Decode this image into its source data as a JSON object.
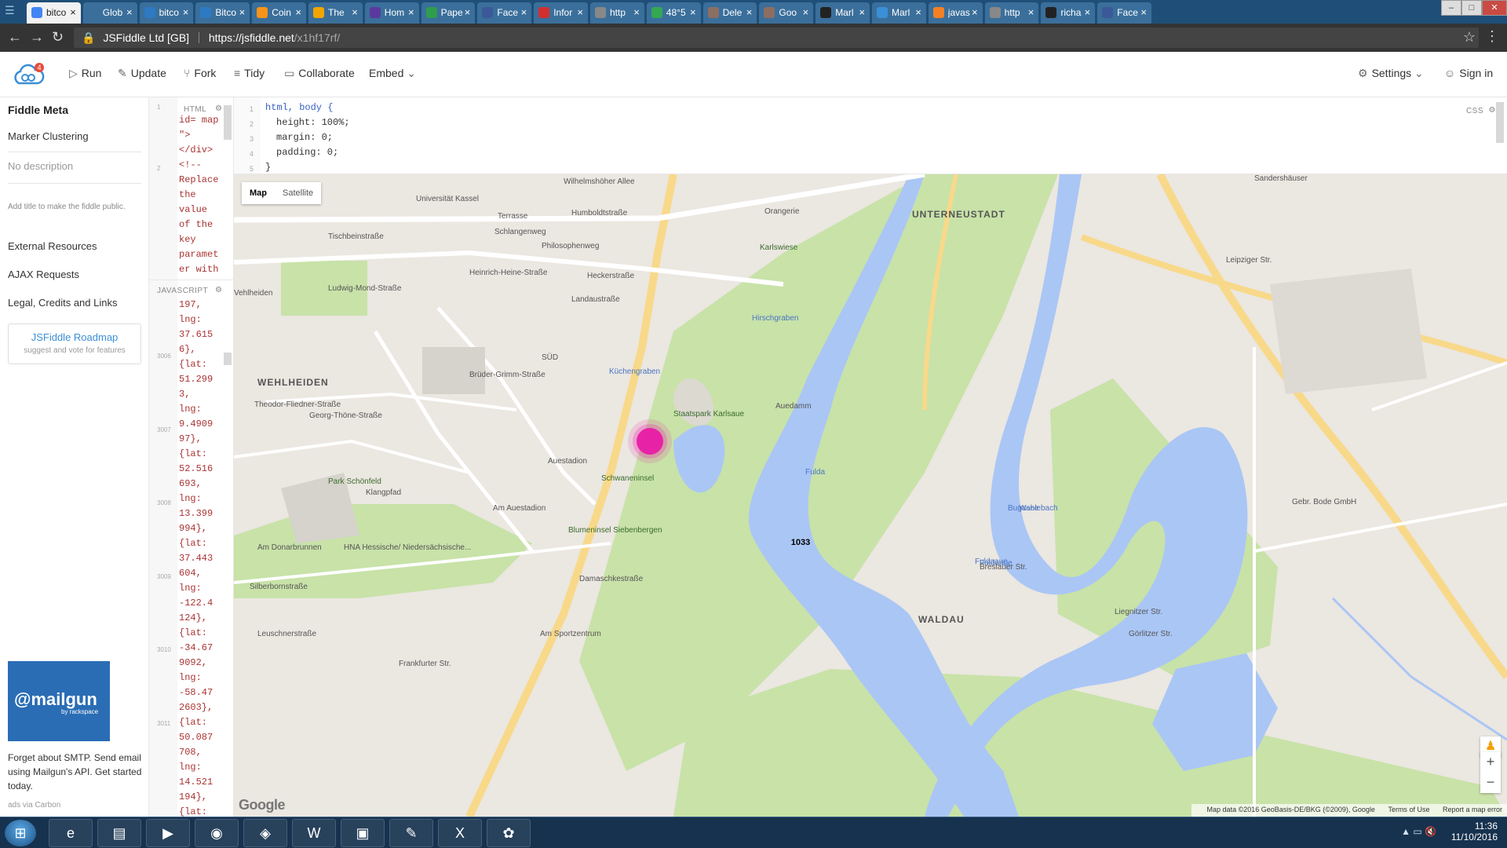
{
  "browser": {
    "tabs": [
      {
        "title": "bitco",
        "icon": "google-icon",
        "color": "#4285f4",
        "active": true
      },
      {
        "title": "Glob",
        "icon": "globe-icon",
        "color": "#3b6f9b"
      },
      {
        "title": "bitco",
        "icon": "doc-icon",
        "color": "#2d7ac2"
      },
      {
        "title": "Bitco",
        "icon": "doc-icon",
        "color": "#2d7ac2"
      },
      {
        "title": "Coin",
        "icon": "bitcoin-icon",
        "color": "#f7931a"
      },
      {
        "title": "The",
        "icon": "doc-icon",
        "color": "#f0a500"
      },
      {
        "title": "Hom",
        "icon": "doc-icon",
        "color": "#5b3aa0"
      },
      {
        "title": "Pape",
        "icon": "doc-icon",
        "color": "#2e9e4c"
      },
      {
        "title": "Face",
        "icon": "facebook-icon",
        "color": "#3b5998"
      },
      {
        "title": "Infor",
        "icon": "doc-icon",
        "color": "#d32f2f"
      },
      {
        "title": "http",
        "icon": "page-icon",
        "color": "#888888"
      },
      {
        "title": "48°5",
        "icon": "maps-icon",
        "color": "#34a853"
      },
      {
        "title": "Dele",
        "icon": "doc-icon",
        "color": "#8d6e63"
      },
      {
        "title": "Goo",
        "icon": "doc-icon",
        "color": "#8d6e63"
      },
      {
        "title": "Marl",
        "icon": "github-icon",
        "color": "#222222"
      },
      {
        "title": "Marl",
        "icon": "cloud-icon",
        "color": "#3a8fd6"
      },
      {
        "title": "javas",
        "icon": "doc-icon",
        "color": "#f48024"
      },
      {
        "title": "http",
        "icon": "page-icon",
        "color": "#888888"
      },
      {
        "title": "richa",
        "icon": "github-icon",
        "color": "#222222"
      },
      {
        "title": "Face",
        "icon": "facebook-icon",
        "color": "#3b5998"
      }
    ],
    "site_name": "JSFiddle Ltd [GB]",
    "url_host": "https://jsfiddle.net",
    "url_path": "/x1hf17rf/"
  },
  "toolbar": {
    "run": "Run",
    "update": "Update",
    "fork": "Fork",
    "tidy": "Tidy",
    "collaborate": "Collaborate",
    "embed": "Embed",
    "settings": "Settings",
    "signin": "Sign in",
    "logo_badge": "4"
  },
  "sidebar": {
    "heading": "Fiddle Meta",
    "title": "Marker Clustering",
    "description": "No description",
    "hint": "Add title to make the fiddle public.",
    "links": [
      "External Resources",
      "AJAX Requests",
      "Legal, Credits and Links"
    ],
    "roadmap": "JSFiddle Roadmap",
    "roadmap_sub": "suggest and vote for features",
    "ad_brand": "@mailgun",
    "ad_sub": "by rackspace",
    "ad_text": "Forget about SMTP. Send email using Mailgun's API. Get started today.",
    "ad_via": "ads via Carbon"
  },
  "editors": {
    "html_label": "HTML",
    "js_label": "JAVASCRIPT",
    "css_label": "CSS",
    "html_lines": [
      "id= map",
      "\">",
      "</div>",
      "<!--",
      "Replace",
      "the",
      "value",
      "of the",
      "key",
      "paramet",
      "er with"
    ],
    "js_lines": [
      "197,",
      "lng:",
      "37.615",
      "6},",
      "{lat:",
      "51.299",
      "3,",
      "lng:",
      "9.4909",
      "97},",
      "{lat:",
      "52.516",
      "693,",
      "lng:",
      "13.399",
      "994},",
      "{lat:",
      "37.443",
      "604,",
      "lng:",
      "-122.4",
      "124},",
      "{lat:",
      "-34.67",
      "9092,",
      "lng:",
      "-58.47",
      "2603},",
      "{lat:",
      "50.087",
      "708,",
      "lng:",
      "14.521",
      "194},",
      "{lat:"
    ],
    "js_gutter": [
      "3006",
      "3007",
      "3008",
      "3009",
      "3010",
      "3011"
    ],
    "css_lines": [
      "html, body {",
      "height: 100%;",
      "margin: 0;",
      "padding: 0;",
      "}"
    ]
  },
  "map": {
    "map_button": "Map",
    "satellite_button": "Satellite",
    "cluster_count": "1033",
    "labels": [
      "Wilhelmshöher Allee",
      "Universität Kassel",
      "Terrasse",
      "Humboldtstraße",
      "Schlangenweg",
      "Orangerie",
      "UNTERNEUSTADT",
      "Tischbeinstraße",
      "Philosophenweg",
      "Karlswiese",
      "Vehlheiden",
      "Heckerstraße",
      "Landaustraße",
      "SÜD",
      "WEHLHEIDEN",
      "Staatspark Karlsaue",
      "Auestadion",
      "Schwaneninsel",
      "Park Schönfeld",
      "Klangpfad",
      "Blumeninsel Siebenbergen",
      "HNA Hessische/ Niedersächsische...",
      "Fuldaaue",
      "Fulda",
      "Bugasee",
      "Leipziger Str.",
      "Gebr. Bode GmbH",
      "WALDAU",
      "Frankfurter Str.",
      "Am Auestadion",
      "Auedamm",
      "Am Donarbrunnen",
      "Silberbornstraße",
      "Leuschnerstraße",
      "Küchengraben",
      "Hirschgraben",
      "Wahlebach",
      "Damaschkestraße",
      "Theodor-Fliedner-Straße",
      "Georg-Thöne-Straße",
      "Ludwig-Mond-Straße",
      "Heinrich-Heine-Straße",
      "Brüder-Grimm-Straße",
      "Sandershäuser",
      "Am Sportzentrum",
      "Fuldaaue",
      "Breslauer Str.",
      "Liegnitzer Str.",
      "Görlitzer Str."
    ],
    "footer_data": "Map data ©2016 GeoBasis-DE/BKG (©2009), Google",
    "footer_terms": "Terms of Use",
    "footer_report": "Report a map error",
    "google": "Google"
  },
  "taskbar": {
    "time": "11:36",
    "date": "11/10/2016"
  }
}
